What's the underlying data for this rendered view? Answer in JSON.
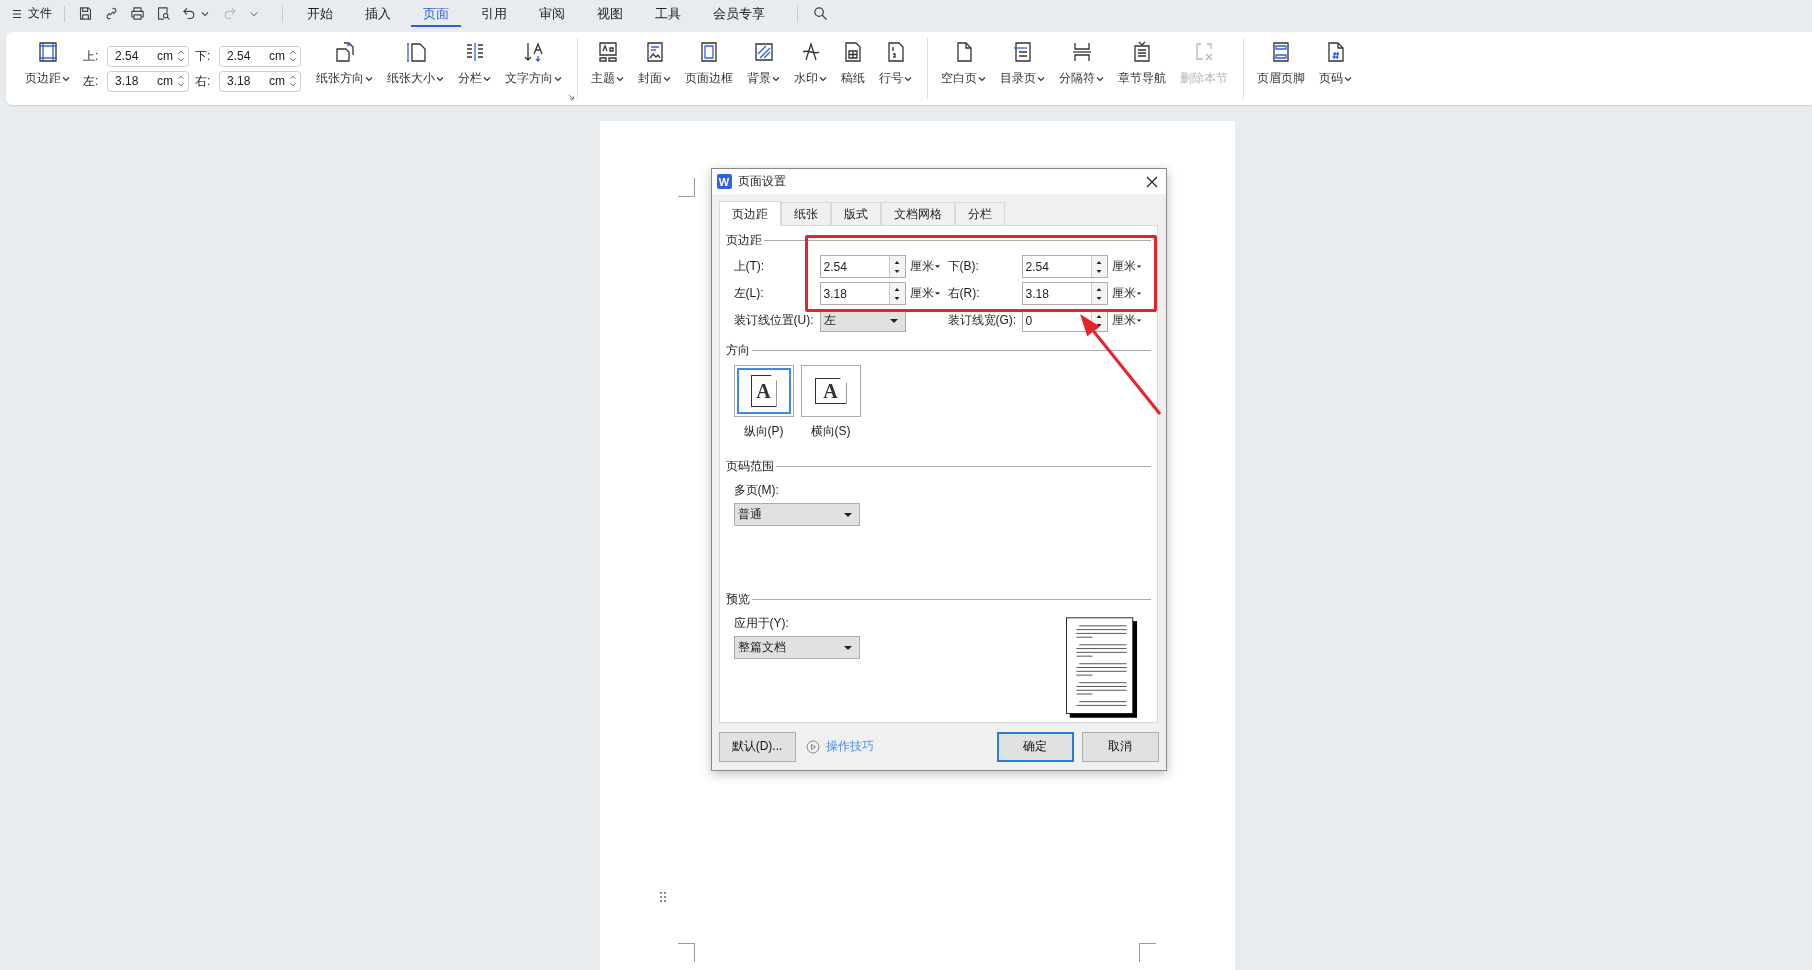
{
  "menubar": {
    "file": "文件",
    "quick_access": [
      {
        "kind": "save",
        "disabled": false
      },
      {
        "kind": "link",
        "disabled": false
      },
      {
        "kind": "print",
        "disabled": false
      },
      {
        "kind": "preview",
        "disabled": false
      },
      {
        "kind": "undo",
        "disabled": false
      },
      {
        "kind": "redo",
        "disabled": true
      },
      {
        "kind": "more",
        "disabled": false
      }
    ],
    "tabs": [
      {
        "label": "开始",
        "selected": false
      },
      {
        "label": "插入",
        "selected": false
      },
      {
        "label": "页面",
        "selected": true
      },
      {
        "label": "引用",
        "selected": false
      },
      {
        "label": "审阅",
        "selected": false
      },
      {
        "label": "视图",
        "selected": false
      },
      {
        "label": "工具",
        "selected": false
      },
      {
        "label": "会员专享",
        "selected": false
      }
    ]
  },
  "ribbon": {
    "margins_button": {
      "label": "页边距",
      "kind": "margins",
      "dropdown": true,
      "disabled": false
    },
    "margin_fields": [
      {
        "label": "上:",
        "value": "2.54",
        "unit": "cm"
      },
      {
        "label": "下:",
        "value": "2.54",
        "unit": "cm"
      },
      {
        "label": "左:",
        "value": "3.18",
        "unit": "cm"
      },
      {
        "label": "右:",
        "value": "3.18",
        "unit": "cm"
      }
    ],
    "groups": [
      [
        {
          "label": "纸张方向",
          "kind": "orientation",
          "dropdown": true,
          "disabled": false
        },
        {
          "label": "纸张大小",
          "kind": "size",
          "dropdown": true,
          "disabled": false
        },
        {
          "label": "分栏",
          "kind": "columns",
          "dropdown": true,
          "disabled": false
        },
        {
          "label": "文字方向",
          "kind": "text_direction",
          "dropdown": true,
          "disabled": false
        }
      ],
      [
        {
          "label": "主题",
          "kind": "theme",
          "dropdown": true,
          "disabled": false
        },
        {
          "label": "封面",
          "kind": "cover",
          "dropdown": true,
          "disabled": false
        },
        {
          "label": "页面边框",
          "kind": "border",
          "dropdown": false,
          "disabled": false
        },
        {
          "label": "背景",
          "kind": "background",
          "dropdown": true,
          "disabled": false
        },
        {
          "label": "水印",
          "kind": "watermark",
          "dropdown": true,
          "disabled": false
        },
        {
          "label": "稿纸",
          "kind": "grid_paper",
          "dropdown": false,
          "disabled": false
        },
        {
          "label": "行号",
          "kind": "line_numbers",
          "dropdown": true,
          "disabled": false
        }
      ],
      [
        {
          "label": "空白页",
          "kind": "blank_page",
          "dropdown": true,
          "disabled": false
        },
        {
          "label": "目录页",
          "kind": "toc_page",
          "dropdown": true,
          "disabled": false
        },
        {
          "label": "分隔符",
          "kind": "breaks",
          "dropdown": true,
          "disabled": false
        },
        {
          "label": "章节导航",
          "kind": "nav",
          "dropdown": false,
          "disabled": false
        },
        {
          "label": "删除本节",
          "kind": "delete_section",
          "dropdown": false,
          "disabled": true
        }
      ],
      [
        {
          "label": "页眉页脚",
          "kind": "header_footer",
          "dropdown": false,
          "disabled": false
        },
        {
          "label": "页码",
          "kind": "page_number",
          "dropdown": true,
          "disabled": false
        }
      ]
    ]
  },
  "dialog": {
    "logo": "W",
    "title": "页面设置",
    "tabs": [
      {
        "label": "页边距",
        "selected": true
      },
      {
        "label": "纸张",
        "selected": false
      },
      {
        "label": "版式",
        "selected": false
      },
      {
        "label": "文档网格",
        "selected": false
      },
      {
        "label": "分栏",
        "selected": false
      }
    ],
    "margins": {
      "legend": "页边距",
      "fields": [
        {
          "label": "上(T):",
          "value": "2.54",
          "unit": "厘米"
        },
        {
          "label": "下(B):",
          "value": "2.54",
          "unit": "厘米"
        },
        {
          "label": "左(L):",
          "value": "3.18",
          "unit": "厘米"
        },
        {
          "label": "右(R):",
          "value": "3.18",
          "unit": "厘米"
        }
      ],
      "gutter_position": {
        "label": "装订线位置(U):",
        "value": "左"
      },
      "gutter_width": {
        "label": "装订线宽(G):",
        "value": "0",
        "unit": "厘米"
      }
    },
    "orientation": {
      "legend": "方向",
      "options": [
        {
          "label": "纵向(P)",
          "glyph": "A",
          "kind": "portrait",
          "selected": true
        },
        {
          "label": "横向(S)",
          "glyph": "A",
          "kind": "landscape",
          "selected": false
        }
      ]
    },
    "page_range": {
      "legend": "页码范围",
      "label": "多页(M):",
      "value": "普通"
    },
    "preview": {
      "legend": "预览",
      "label": "应用于(Y):",
      "value": "整篇文档"
    },
    "footer": {
      "default_button": "默认(D)...",
      "tips_link": "操作技巧",
      "buttons": [
        {
          "label": "确定",
          "default": true
        },
        {
          "label": "取消",
          "default": false
        }
      ]
    }
  }
}
